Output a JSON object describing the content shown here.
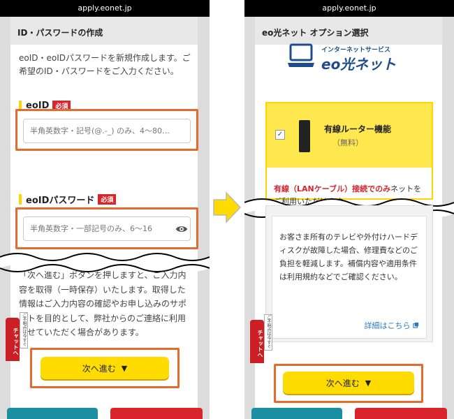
{
  "colors": {
    "accent_yellow": "#ffdc00",
    "highlight_orange": "#e66a2c",
    "required_red": "#d9242b",
    "link_blue": "#2b78c5"
  },
  "left": {
    "status_url": "apply.eonet.jp",
    "title": "ID・パスワードの作成",
    "intro": "eoID・eoIDパスワードを新規作成します。ご希望のID・パスワードをご入力ください。",
    "eoid_label": "eoID",
    "eoid_required": "必須",
    "eoid_placeholder": "半角英数字・記号(@.-_) のみ、4〜80…",
    "password_label": "eoIDパスワード",
    "password_required": "必須",
    "password_placeholder": "半角英数字・一部記号のみ、6〜16",
    "eye_icon": "eye-icon",
    "bottom_text": "「次へ進む」ボタンを押しますと、ご入力内容を取得（一時保存）いたします。取得した情報はご入力内容の確認やお申し込みのサポートを目的として、弊社からのご連絡に利用させていただく場合があります。",
    "chat_tab": "チャットへ",
    "chat_note": "ご不明点は今すぐ",
    "next_button": "次へ進む",
    "next_icon": "▼"
  },
  "right": {
    "status_url": "apply.eonet.jp",
    "title": "eo光ネット オプション選択",
    "logo_sub": "インターネットサービス",
    "logo_main": "eo光ネット",
    "option_title": "有線ルーター機能",
    "option_price": "（無料）",
    "option_desc_red": "有線（LANケーブル）接続でのみ",
    "option_desc_rest": "ネットをご利用いただけます",
    "checkbox_mark": "✓",
    "detail_text": "お客さま所有のテレビや外付けハードディスクが故障した場合、修理費などのご負担を軽減します。補償内容や適用条件は利用規約などでご確認ください。",
    "detail_link": "詳細はこちら",
    "chat_tab": "チャットへ",
    "chat_note": "ご不明点は今すぐ",
    "next_button": "次へ進む",
    "next_icon": "▼"
  }
}
